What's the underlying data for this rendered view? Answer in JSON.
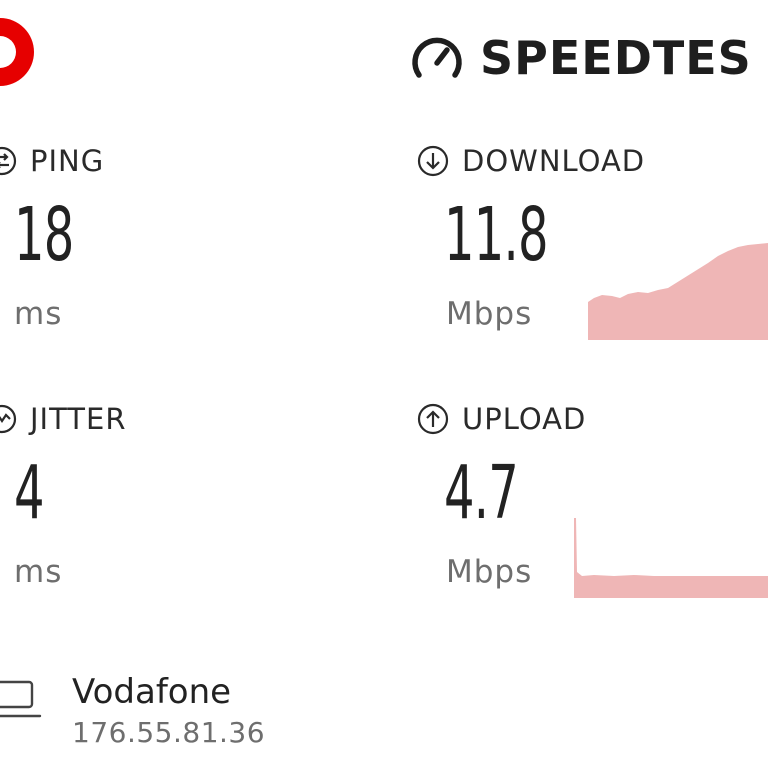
{
  "brand": {
    "name": "SPEEDTES",
    "logo_icon": "vodafone-logo-icon",
    "logo_color": "#e60000",
    "speedometer_icon": "speedometer-icon"
  },
  "ping": {
    "label": "PING",
    "value": "18",
    "unit": "ms",
    "icon": "ping-icon"
  },
  "jitter": {
    "label": "JITTER",
    "value": "4",
    "unit": "ms",
    "icon": "jitter-icon"
  },
  "download": {
    "label": "DOWNLOAD",
    "value": "11.8",
    "unit": "Mbps",
    "icon": "download-arrow-icon",
    "graph_color": "#efb6b6"
  },
  "upload": {
    "label": "UPLOAD",
    "value": "4.7",
    "unit": "Mbps",
    "icon": "upload-arrow-icon",
    "graph_color": "#efb6b6"
  },
  "provider": {
    "name": "Vodafone",
    "ip": "176.55.81.36",
    "icon": "laptop-icon"
  }
}
